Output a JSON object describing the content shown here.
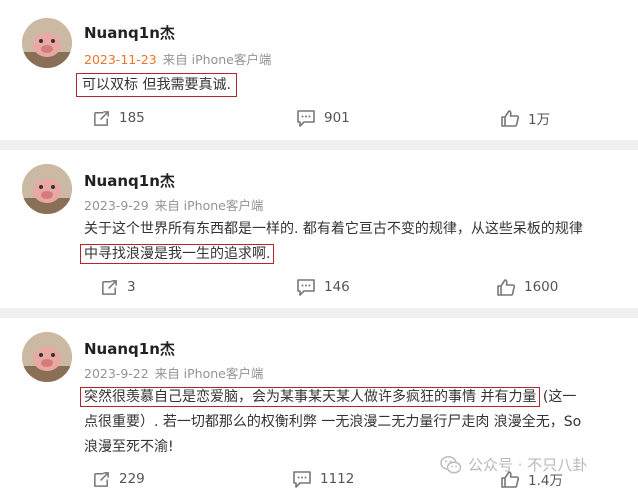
{
  "comments": [
    {
      "user": "Nuanq1n杰",
      "date": "2023-11-23",
      "source": "来自 iPhone客户端",
      "text": "可以双标 但我需要真诚.",
      "reposts": "185",
      "comments": "901",
      "likes": "1万"
    },
    {
      "user": "Nuanq1n杰",
      "date": "2023-9-29",
      "source": "来自 iPhone客户端",
      "text_line1": "关于这个世界所有东西都是一样的. 都有着它亘古不变的规律，从这些呆板的规律",
      "text_line2": "中寻找浪漫是我一生的追求啊.",
      "reposts": "3",
      "comments": "146",
      "likes": "1600"
    },
    {
      "user": "Nuanq1n杰",
      "date": "2023-9-22",
      "source": "来自 iPhone客户端",
      "text_highlight": "突然很羡慕自己是恋爱脑，会为某事某天某人做许多疯狂的事情 并有力量",
      "text_tail": "(这一",
      "text_line2": "点很重要）. 若一切都那么的权衡利弊 一无浪漫二无力量行尸走肉 浪漫全无，So",
      "text_line3": "浪漫至死不渝!",
      "reposts": "229",
      "comments": "1112",
      "likes": "1.4万"
    }
  ],
  "watermark": "公众号 · 不只八卦",
  "colors": {
    "date_highlight": "#e8762c",
    "outline": "#b2272e",
    "meta": "#939393"
  },
  "icons": [
    "avatar",
    "repost-icon",
    "comment-icon",
    "like-icon",
    "wechat-icon"
  ]
}
